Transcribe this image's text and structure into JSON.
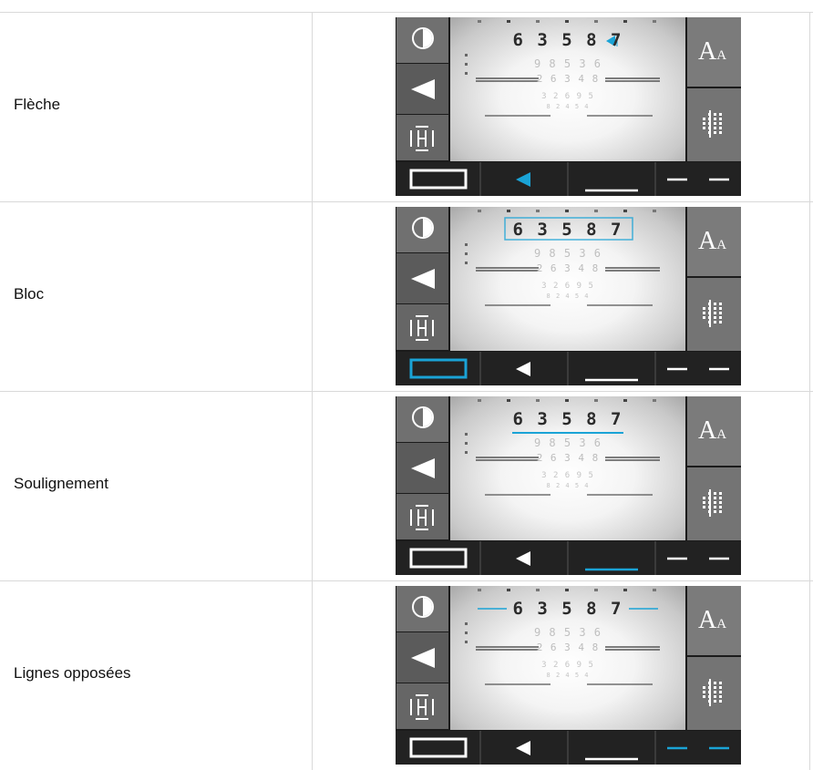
{
  "rows": [
    {
      "label": "Flèche",
      "mode": "arrow"
    },
    {
      "label": "Bloc",
      "mode": "box"
    },
    {
      "label": "Soulignement",
      "mode": "underline"
    },
    {
      "label": "Lignes opposées",
      "mode": "lines"
    }
  ],
  "chart_lines": [
    "6 3 5 8 7",
    "9 8 5 3 6",
    "2 6 3 4 8",
    "3 2 6 9 5",
    "8 2 4 5 4"
  ],
  "buttons": {
    "contrast": "contrast-icon",
    "arrow": "arrow-left-icon",
    "size_label": "A",
    "size_small": "A",
    "grid": "grid-icon",
    "hline": "H"
  },
  "colors": {
    "accent": "#1aa3d6",
    "bg": "#1b1b1b"
  }
}
